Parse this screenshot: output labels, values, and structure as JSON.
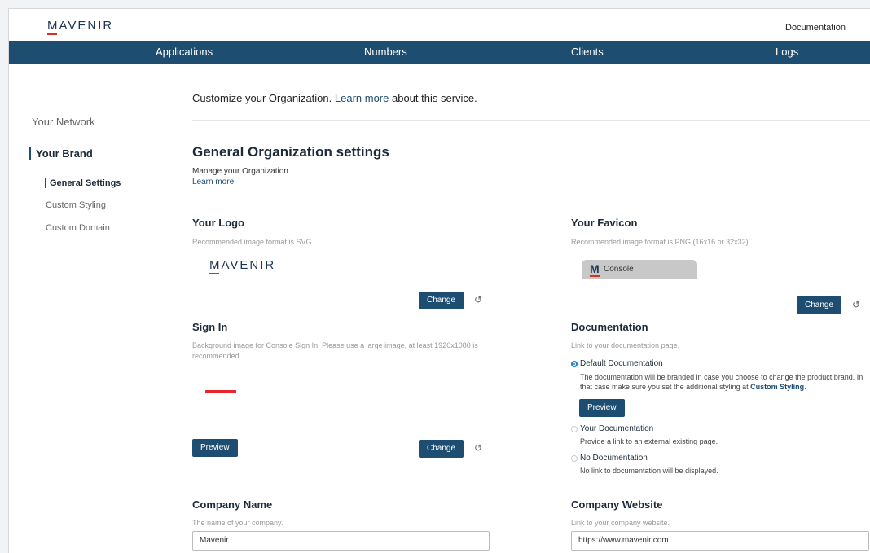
{
  "header": {
    "logo": "MAVENIR",
    "documentation_link": "Documentation"
  },
  "nav": {
    "items": [
      "Applications",
      "Numbers",
      "Clients",
      "Logs"
    ]
  },
  "sidebar": {
    "network": "Your Network",
    "brand": "Your Brand",
    "items": [
      "General Settings",
      "Custom Styling",
      "Custom Domain"
    ],
    "active_item": "General Settings"
  },
  "intro": {
    "text_before": "Customize your Organization.",
    "link": "Learn more",
    "text_after": "about this service."
  },
  "page": {
    "title": "General Organization settings",
    "subtitle": "Manage your Organization",
    "learn_more": "Learn more"
  },
  "logo_section": {
    "title": "Your Logo",
    "description": "Recommended image format is SVG.",
    "preview_text": "MAVENIR",
    "change_label": "Change"
  },
  "favicon_section": {
    "title": "Your Favicon",
    "description": "Recommended image format is PNG (16x16 or 32x32).",
    "tab_icon": "M",
    "tab_text": "Console",
    "change_label": "Change"
  },
  "signin_section": {
    "title": "Sign In",
    "description": "Background image for Console Sign In. Please use a large image, at least 1920x1080 is recommended.",
    "preview_label": "Preview",
    "change_label": "Change"
  },
  "documentation_section": {
    "title": "Documentation",
    "description": "Link to your documentation page.",
    "options": [
      {
        "label": "Default Documentation",
        "checked": true,
        "description": "The documentation will be branded in case you choose to change the product brand. In that case make sure you set the additional styling at",
        "link": "Custom Styling",
        "suffix": "."
      },
      {
        "label": "Your Documentation",
        "checked": false,
        "description": "Provide a link to an external existing page."
      },
      {
        "label": "No Documentation",
        "checked": false,
        "description": "No link to documentation will be displayed."
      }
    ],
    "preview_label": "Preview"
  },
  "company_name": {
    "title": "Company Name",
    "description": "The name of your company.",
    "value": "Mavenir"
  },
  "company_website": {
    "title": "Company Website",
    "description": "Link to your company website.",
    "value": "https://www.mavenir.com"
  },
  "colors": {
    "nav_bg": "#1e4d72",
    "button_bg": "#1e4d72",
    "accent_red": "#e8252b",
    "radio_blue": "#1e7bd8"
  }
}
